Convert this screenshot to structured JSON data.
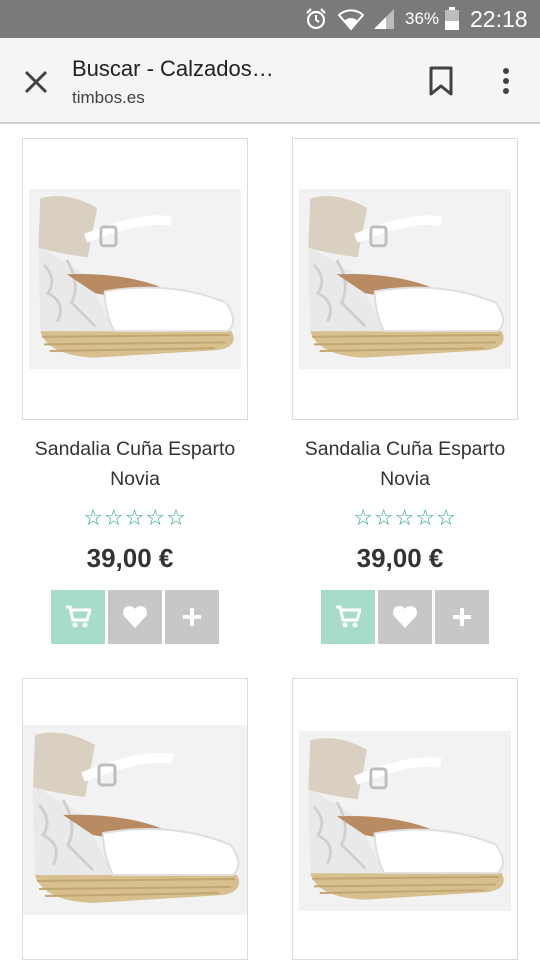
{
  "status_bar": {
    "battery_percent": "36%",
    "time": "22:18",
    "icons": [
      "alarm-icon",
      "wifi-icon",
      "signal-icon",
      "battery-icon"
    ]
  },
  "toolbar": {
    "title": "Buscar - Calzados…",
    "url": "timbos.es",
    "icons": [
      "close-icon",
      "bookmark-icon",
      "more-vert-icon"
    ]
  },
  "products": [
    {
      "name": "Sandalia Cuña Esparto Novia",
      "rating_stars": 0,
      "price": "39,00 €",
      "image": "white-lace-wedge-sandal"
    },
    {
      "name": "Sandalia Cuña Esparto Novia",
      "rating_stars": 0,
      "price": "39,00 €",
      "image": "white-lace-wedge-sandal"
    },
    {
      "name": "",
      "price": "",
      "image": "white-lace-t-strap-wedge-sandal"
    },
    {
      "name": "",
      "price": "",
      "image": "white-studded-wedge-sandal"
    }
  ],
  "colors": {
    "status_bar": "#7a7a7a",
    "toolbar": "#f5f5f5",
    "star_outline": "#2aa596",
    "cart_button": "#a7dccd",
    "secondary_button": "#c7c7c7",
    "text": "#333333"
  }
}
